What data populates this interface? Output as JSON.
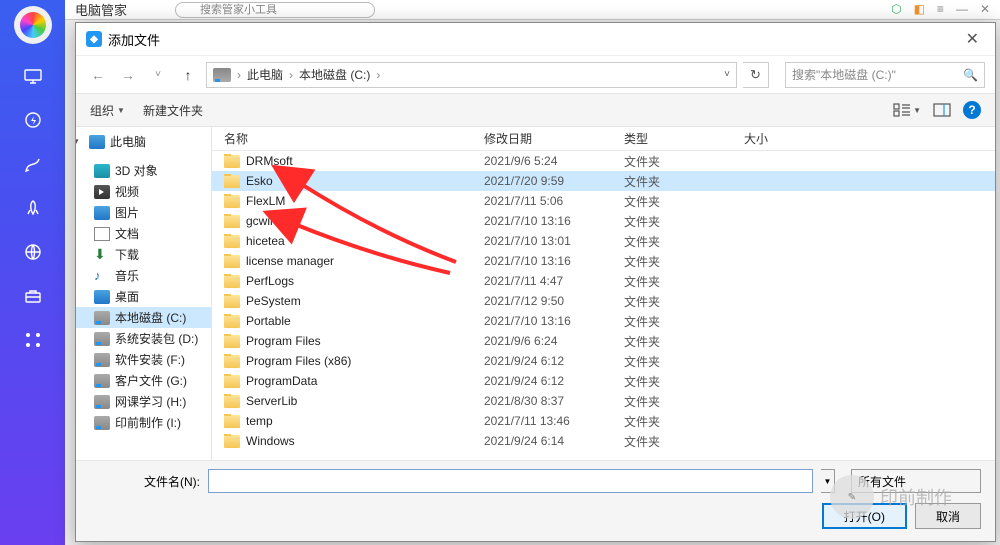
{
  "background": {
    "desktop_label": "电脑管家",
    "search_placeholder": "搜索管家小工具"
  },
  "dialog": {
    "title": "添加文件",
    "breadcrumb": {
      "root": "此电脑",
      "drive": "本地磁盘 (C:)",
      "sep": "›"
    },
    "search_placeholder": "搜索\"本地磁盘 (C:)\"",
    "toolbar": {
      "organize": "组织",
      "newfolder": "新建文件夹"
    },
    "columns": {
      "name": "名称",
      "date": "修改日期",
      "type": "类型",
      "size": "大小"
    },
    "filename_label": "文件名(N):",
    "filter_label": "所有文件",
    "open_btn": "打开(O)",
    "cancel_btn": "取消"
  },
  "tree": [
    {
      "icon": "ico-pc",
      "label": "此电脑",
      "caret": true
    },
    {
      "icon": "ico-3d",
      "label": "3D 对象"
    },
    {
      "icon": "ico-vid",
      "label": "视频"
    },
    {
      "icon": "ico-img",
      "label": "图片"
    },
    {
      "icon": "ico-doc",
      "label": "文档"
    },
    {
      "icon": "ico-dl",
      "label": "下载"
    },
    {
      "icon": "ico-music",
      "label": "音乐"
    },
    {
      "icon": "ico-desk",
      "label": "桌面"
    },
    {
      "icon": "ico-drive",
      "label": "本地磁盘 (C:)",
      "sel": true
    },
    {
      "icon": "ico-drive",
      "label": "系统安装包 (D:)"
    },
    {
      "icon": "ico-drive",
      "label": "软件安装 (F:)"
    },
    {
      "icon": "ico-drive",
      "label": "客户文件 (G:)"
    },
    {
      "icon": "ico-drive",
      "label": "网课学习 (H:)"
    },
    {
      "icon": "ico-drive",
      "label": "印前制作 (I:)"
    }
  ],
  "files": [
    {
      "name": "DRMsoft",
      "date": "2021/9/6 5:24",
      "type": "文件夹"
    },
    {
      "name": "Esko",
      "date": "2021/7/20 9:59",
      "type": "文件夹",
      "sel": true
    },
    {
      "name": "FlexLM",
      "date": "2021/7/11 5:06",
      "type": "文件夹"
    },
    {
      "name": "gcwin",
      "date": "2021/7/10 13:16",
      "type": "文件夹"
    },
    {
      "name": "hicetea",
      "date": "2021/7/10 13:01",
      "type": "文件夹"
    },
    {
      "name": "license manager",
      "date": "2021/7/10 13:16",
      "type": "文件夹"
    },
    {
      "name": "PerfLogs",
      "date": "2021/7/11 4:47",
      "type": "文件夹"
    },
    {
      "name": "PeSystem",
      "date": "2021/7/12 9:50",
      "type": "文件夹"
    },
    {
      "name": "Portable",
      "date": "2021/7/10 13:16",
      "type": "文件夹"
    },
    {
      "name": "Program Files",
      "date": "2021/9/6 6:24",
      "type": "文件夹"
    },
    {
      "name": "Program Files (x86)",
      "date": "2021/9/24 6:12",
      "type": "文件夹"
    },
    {
      "name": "ProgramData",
      "date": "2021/9/24 6:12",
      "type": "文件夹"
    },
    {
      "name": "ServerLib",
      "date": "2021/8/30 8:37",
      "type": "文件夹"
    },
    {
      "name": "temp",
      "date": "2021/7/11 13:46",
      "type": "文件夹"
    },
    {
      "name": "Windows",
      "date": "2021/9/24 6:14",
      "type": "文件夹"
    }
  ],
  "watermark": "印前制作"
}
